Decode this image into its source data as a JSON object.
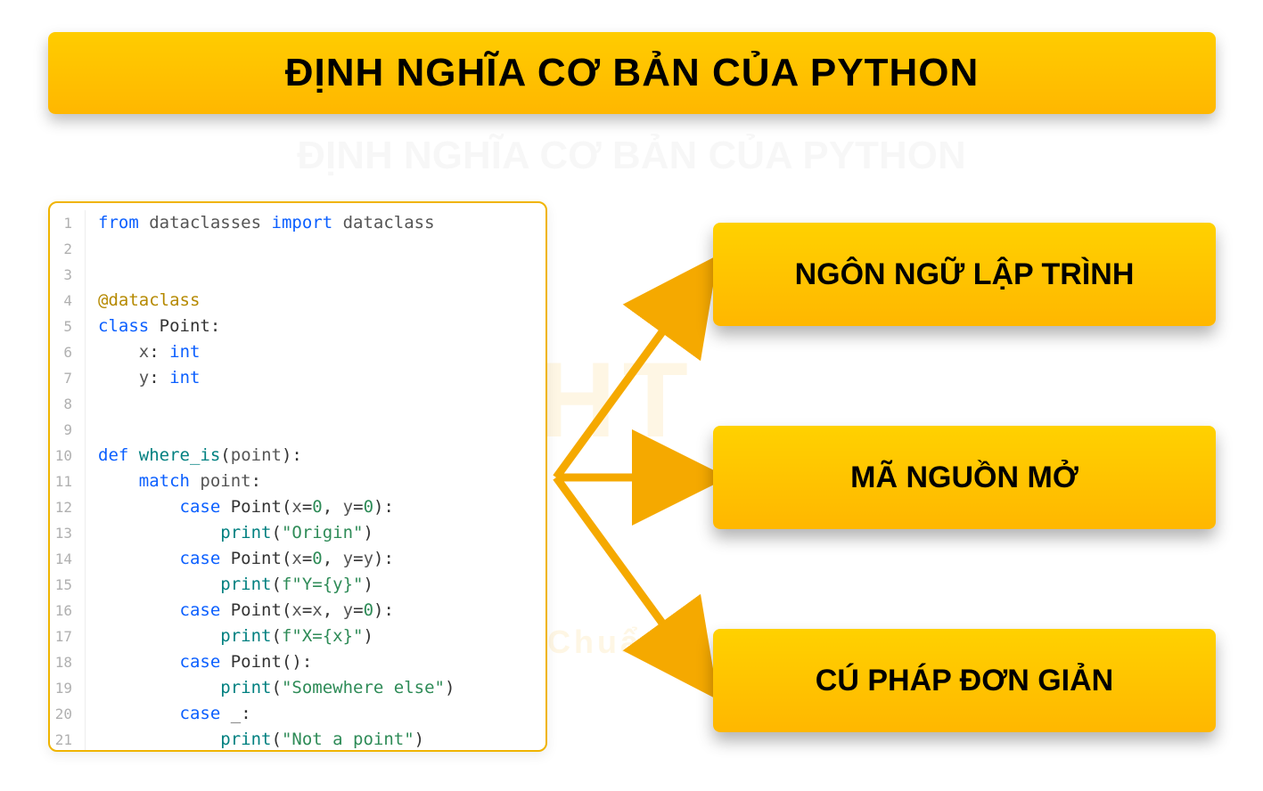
{
  "title": "ĐỊNH NGHĨA CƠ BẢN CỦA PYTHON",
  "faded_title": "ĐỊNH NGHĨA CƠ BẢN CỦA PYTHON",
  "watermark": "LIGHT",
  "watermark_sub": "Nhanh – Chuẩn",
  "features": [
    {
      "label": "NGÔN NGỮ LẬP TRÌNH"
    },
    {
      "label": "MÃ NGUỒN MỞ"
    },
    {
      "label": "CÚ PHÁP ĐƠN GIẢN"
    }
  ],
  "code": {
    "line_numbers": [
      "1",
      "2",
      "3",
      "4",
      "5",
      "6",
      "7",
      "8",
      "9",
      "10",
      "11",
      "12",
      "13",
      "14",
      "15",
      "16",
      "17",
      "18",
      "19",
      "20",
      "21"
    ],
    "tokens": {
      "from": "from",
      "import": "import",
      "dataclasses": "dataclasses",
      "dataclass": "dataclass",
      "decorator": "@dataclass",
      "class": "class",
      "Point": "Point",
      "x": "x",
      "y": "y",
      "int": "int",
      "def": "def",
      "where_is": "where_is",
      "point": "point",
      "match": "match",
      "case": "case",
      "print": "print",
      "origin": "\"Origin\"",
      "y_fmt": "f\"Y={y}\"",
      "x_fmt": "f\"X={x}\"",
      "somewhere": "\"Somewhere else\"",
      "notpoint": "\"Not a point\"",
      "zero": "0",
      "underscore": "_",
      "colon": ":",
      "comma": ",",
      "lparen": "(",
      "rparen": ")",
      "eq": "="
    }
  }
}
